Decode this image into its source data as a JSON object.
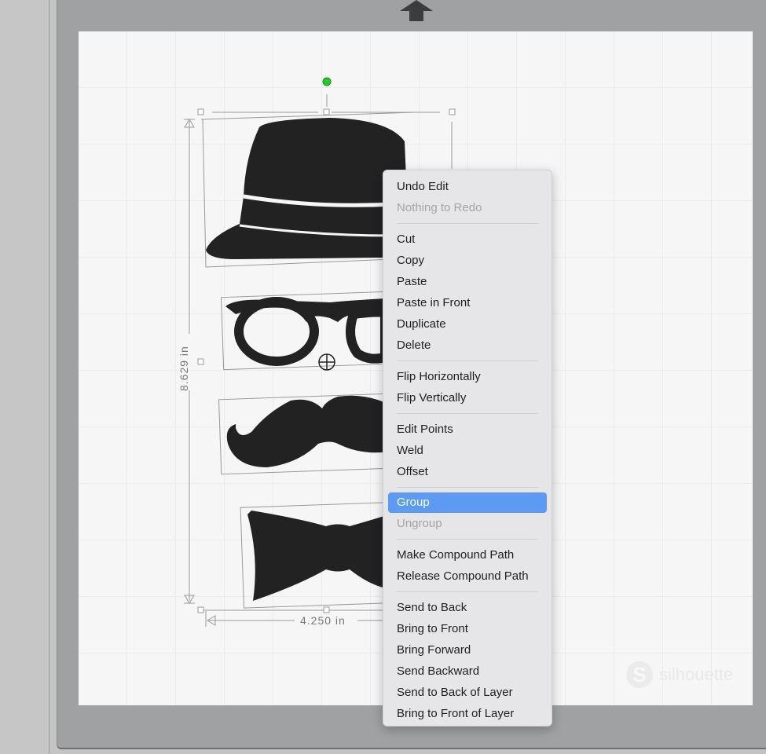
{
  "selection": {
    "height_label": "8.629 in",
    "width_label": "4.250 in"
  },
  "watermark": "silhouette",
  "colors": {
    "highlight": "#5b9bf4",
    "rotate_handle": "#22cc22",
    "shape_fill": "#222222"
  },
  "context_menu": {
    "groups": [
      [
        {
          "label": "Undo Edit",
          "enabled": true
        },
        {
          "label": "Nothing to Redo",
          "enabled": false
        }
      ],
      [
        {
          "label": "Cut",
          "enabled": true
        },
        {
          "label": "Copy",
          "enabled": true
        },
        {
          "label": "Paste",
          "enabled": true
        },
        {
          "label": "Paste in Front",
          "enabled": true
        },
        {
          "label": "Duplicate",
          "enabled": true
        },
        {
          "label": "Delete",
          "enabled": true
        }
      ],
      [
        {
          "label": "Flip Horizontally",
          "enabled": true
        },
        {
          "label": "Flip Vertically",
          "enabled": true
        }
      ],
      [
        {
          "label": "Edit Points",
          "enabled": true
        },
        {
          "label": "Weld",
          "enabled": true
        },
        {
          "label": "Offset",
          "enabled": true
        }
      ],
      [
        {
          "label": "Group",
          "enabled": true,
          "highlighted": true
        },
        {
          "label": "Ungroup",
          "enabled": false
        }
      ],
      [
        {
          "label": "Make Compound Path",
          "enabled": true
        },
        {
          "label": "Release Compound Path",
          "enabled": true
        }
      ],
      [
        {
          "label": "Send to Back",
          "enabled": true
        },
        {
          "label": "Bring to Front",
          "enabled": true
        },
        {
          "label": "Bring Forward",
          "enabled": true
        },
        {
          "label": "Send Backward",
          "enabled": true
        },
        {
          "label": "Send to Back of Layer",
          "enabled": true
        },
        {
          "label": "Bring to Front of Layer",
          "enabled": true
        }
      ]
    ]
  }
}
